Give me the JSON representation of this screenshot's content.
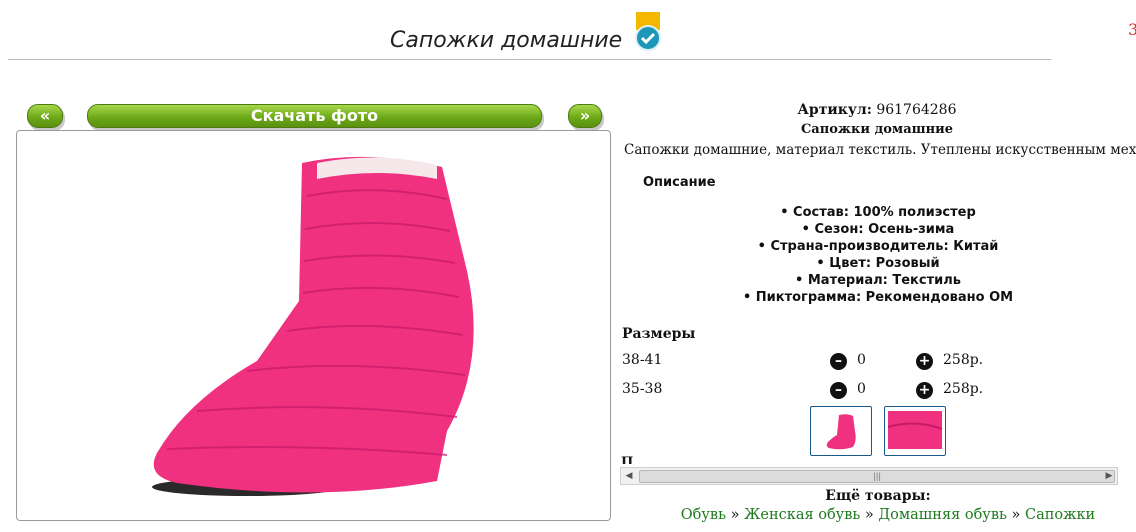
{
  "page": {
    "title": "Сапожки домашние",
    "edge_char": "3"
  },
  "gallery": {
    "prev_label": "«",
    "download_label": "Скачать фото",
    "next_label": "»"
  },
  "product": {
    "article_label": "Артикул:",
    "article_value": "961764286",
    "name": "Сапожки домашние",
    "description": "Сапожки домашние, материал текстиль. Утеплены искусственным мехом.",
    "description_heading": "Описание",
    "specs": [
      "Состав: 100% полиэстер",
      "Сезон: Осень-зима",
      "Страна-производитель: Китай",
      "Цвет: Розовый",
      "Материал: Текстиль",
      "Пиктограмма: Рекомендовано ОМ"
    ]
  },
  "sizes": {
    "heading": "Размеры",
    "rows": [
      {
        "size": "38-41",
        "minus": "–",
        "qty": "0",
        "plus": "+",
        "price": "258р."
      },
      {
        "size": "35-38",
        "minus": "–",
        "qty": "0",
        "plus": "+",
        "price": "258р."
      }
    ]
  },
  "cut_text": "П",
  "more": {
    "heading": "Ещё товары:",
    "crumbs": [
      "Обувь",
      "Женская обувь",
      "Домашняя обувь",
      "Сапожки"
    ],
    "separator": " » "
  },
  "colors": {
    "accent_green": "#6aa616",
    "product_pink": "#f0317f",
    "link_green": "#1f7a1f"
  },
  "icons": [
    "verified-badge-icon",
    "minus-circle-icon",
    "plus-circle-icon"
  ]
}
